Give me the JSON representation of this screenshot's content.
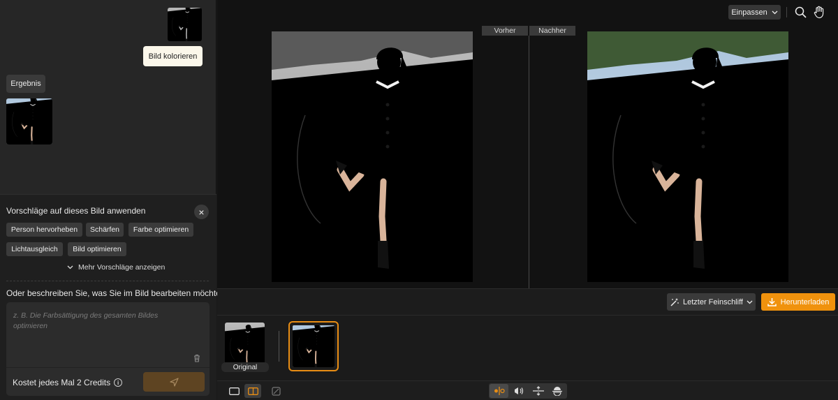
{
  "chat": {
    "user_message": "Bild kolorieren",
    "result_label": "Ergebnis"
  },
  "suggestions": {
    "title": "Vorschläge auf dieses Bild anwenden",
    "chips": [
      "Person hervorheben",
      "Schärfen",
      "Farbe optimieren",
      "Lichtausgleich",
      "Bild optimieren"
    ],
    "more_label": "Mehr Vorschläge anzeigen"
  },
  "prompt": {
    "label": "Oder beschreiben Sie, was Sie im Bild bearbeiten möchten",
    "placeholder": "z. B. Die Farbsättigung des gesamten Bildes optimieren",
    "credits_text": "Kostet jedes Mal 2 Credits"
  },
  "canvas": {
    "fit_label": "Einpassen",
    "before_label": "Vorher",
    "after_label": "Nachher"
  },
  "toolbar": {
    "refine_label": "Letzter Feinschliff",
    "download_label": "Herunterladen"
  },
  "filmstrip": {
    "original_label": "Original"
  },
  "colors": {
    "accent": "#f0920d",
    "panel": "#262626",
    "canvas_bg": "#121212"
  },
  "icons": [
    "search-icon",
    "hand-icon",
    "close-icon",
    "chevron-down-icon",
    "trash-icon",
    "info-icon",
    "send-icon",
    "magic-wand-icon",
    "download-icon",
    "single-view-icon",
    "split-view-icon",
    "compare-icon",
    "split-vertical-icon",
    "mirror-icon",
    "split-horizontal-icon",
    "overlay-icon"
  ]
}
